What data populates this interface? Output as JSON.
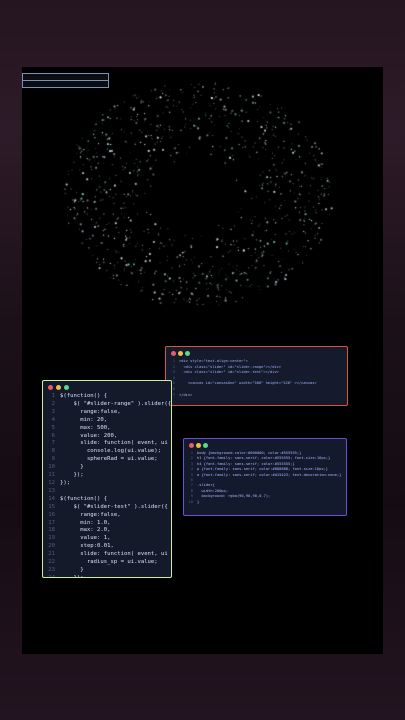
{
  "windows": {
    "js": {
      "lines": [
        "$(function() {",
        "    $( \"#slider-range\" ).slider({",
        "      range:false,",
        "      min: 20,",
        "      max: 500,",
        "      value: 200,",
        "      slide: function( event, ui ) {",
        "        console.log(ui.value);",
        "        sphereRad = ui.value;",
        "      }",
        "    });",
        "});",
        "",
        "$(function() {",
        "    $( \"#slider-test\" ).slider({",
        "      range:false,",
        "      min: 1.0,",
        "      max: 2.0,",
        "      value: 1,",
        "      step:0.01,",
        "      slide: function( event, ui ) {",
        "        radius_sp = ui.value;",
        "      }",
        "    });",
        "});"
      ]
    },
    "html": {
      "lines": [
        "<div style=\"text-align:center\">",
        "  <div class=\"slider\" id=\"slider-range\"></div>",
        "  <div class=\"slider\" id=\"slider-test\"></div>",
        "",
        "    <canvas id=\"canvasOne\" width=\"500\" height=\"520\" ></canvas>",
        "",
        "</div>"
      ]
    },
    "css": {
      "lines": [
        "body {background-color:#000000; color:#555555;}",
        "h1 {font-family: sans-serif; color:#555555; font-size:16px;}",
        "h4 {font-family: sans-serif; color:#555555;}",
        "p {font-family: sans-serif; color:#888888; font-size:16px;}",
        "a {font-family: sans-serif; color:#d15423; text-decoration:none;}",
        "",
        ".slider{",
        "  width:200px;",
        "  background: rgba(90,90,90,0.7);",
        "}"
      ]
    }
  },
  "particles": {
    "colors": [
      "#e8f4ff",
      "#cfe3ff",
      "#a8f0dc",
      "#ffffff"
    ]
  }
}
